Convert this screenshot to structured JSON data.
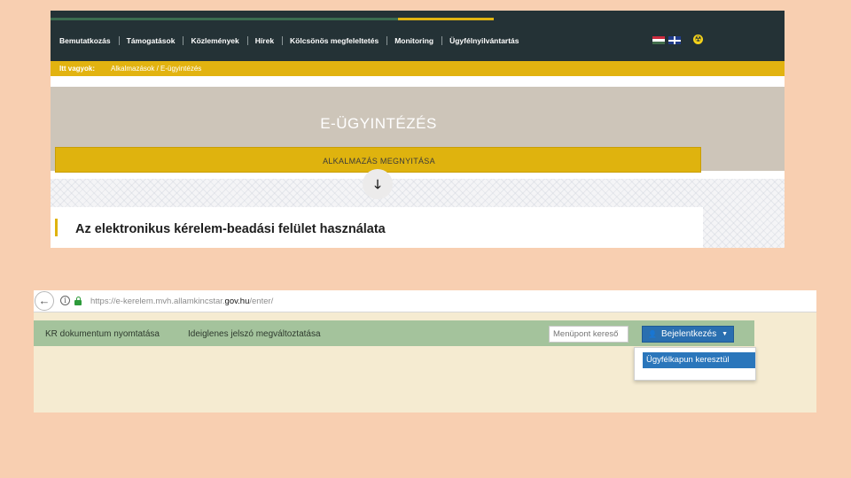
{
  "site": {
    "nav_items": [
      "Bemutatkozás",
      "Támogatások",
      "Közlemények",
      "Hírek",
      "Kölcsönös megfeleltetés",
      "Monitoring",
      "Ügyfélnyilvántartás"
    ],
    "breadcrumb_label": "Itt vagyok:",
    "breadcrumb_path": "Alkalmazások / E-ügyintézés",
    "hero_title": "E-ÜGYINTÉZÉS",
    "hero_button": "ALKALMAZÁS MEGNYITÁSA",
    "scroll_glyph": "🡓",
    "article_title": "Az elektronikus kérelem-beadási felület használata"
  },
  "browser": {
    "back_glyph": "←",
    "info_glyph": "i",
    "url_prefix": "https://e-kerelem.mvh.allamkincstar.",
    "url_domain": "gov.hu",
    "url_suffix": "/enter/"
  },
  "app": {
    "link_kr": "KR dokumentum nyomtatása",
    "link_password": "Ideiglenes jelszó megváltoztatása",
    "search_placeholder": "Menüpont kereső",
    "login_label": "Bejelentkezés",
    "user_glyph": "👤",
    "caret_glyph": "▼",
    "dropdown_item": "Ügyfélkapun keresztül"
  },
  "colors": {
    "nav_bg": "#243236",
    "accent_yellow": "#dfb30e",
    "app_green": "#a4c39c",
    "login_blue": "#2a6fb0"
  }
}
